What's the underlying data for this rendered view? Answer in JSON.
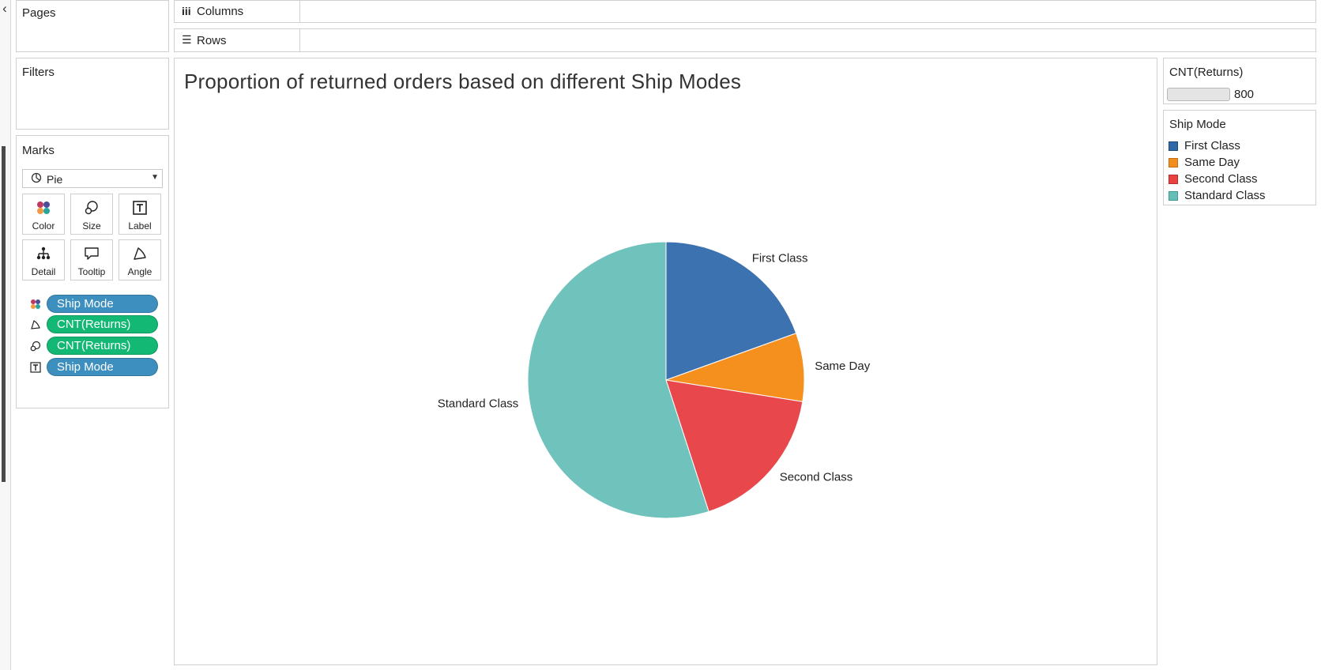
{
  "panels": {
    "pages": "Pages",
    "filters": "Filters",
    "marks": "Marks"
  },
  "marks": {
    "type": "Pie",
    "buttons": {
      "color": "Color",
      "size": "Size",
      "label": "Label",
      "detail": "Detail",
      "tooltip": "Tooltip",
      "angle": "Angle"
    },
    "fields": [
      {
        "icon": "color-icon",
        "label": "Ship Mode",
        "kind": "dimension"
      },
      {
        "icon": "angle-icon",
        "label": "CNT(Returns)",
        "kind": "measure"
      },
      {
        "icon": "size-icon",
        "label": "CNT(Returns)",
        "kind": "measure"
      },
      {
        "icon": "label-icon",
        "label": "Ship Mode",
        "kind": "dimension"
      }
    ]
  },
  "shelves": {
    "columns": "Columns",
    "rows": "Rows"
  },
  "view": {
    "title": "Proportion of returned orders based on different Ship Modes"
  },
  "size_legend": {
    "title": "CNT(Returns)",
    "max_label": "800"
  },
  "color_legend": {
    "title": "Ship Mode",
    "items": [
      {
        "label": "First Class",
        "color": "#2f6aa8"
      },
      {
        "label": "Same Day",
        "color": "#f28e1c"
      },
      {
        "label": "Second Class",
        "color": "#e8413f"
      },
      {
        "label": "Standard Class",
        "color": "#63c0b8"
      }
    ]
  },
  "chart_data": {
    "type": "pie",
    "categories": [
      "First Class",
      "Same Day",
      "Second Class",
      "Standard Class"
    ],
    "values": [
      19.5,
      8.0,
      17.5,
      55.0
    ],
    "colors": [
      "#3d72b0",
      "#f5901f",
      "#e8474c",
      "#70c2bc"
    ],
    "title": "Proportion of returned orders based on different Ship Modes",
    "start_angle": "12 o'clock",
    "direction": "clockwise"
  }
}
